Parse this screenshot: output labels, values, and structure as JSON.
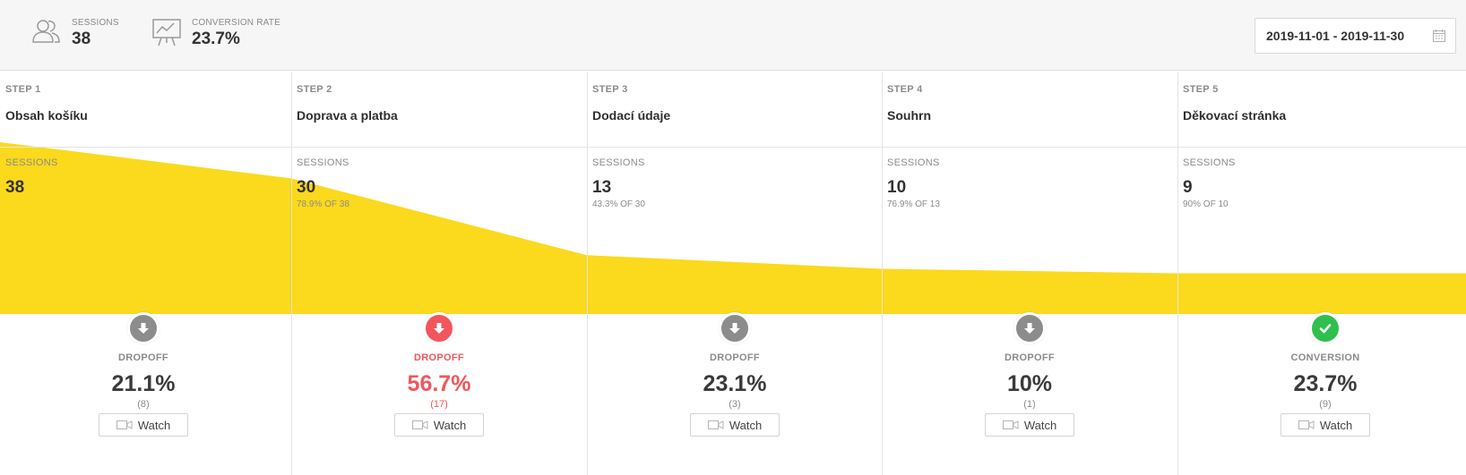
{
  "header": {
    "sessions": {
      "label": "SESSIONS",
      "value": "38",
      "icon": "users-icon"
    },
    "conversion": {
      "label": "CONVERSION RATE",
      "value": "23.7%",
      "icon": "presentation-chart-icon"
    },
    "date_range": {
      "value": "2019-11-01 - 2019-11-30",
      "icon": "calendar-icon"
    }
  },
  "colors": {
    "funnel_fill": "#fbd91c",
    "dropoff_gray": "#8c8c8c",
    "dropoff_red": "#f0565b",
    "conversion_green": "#2fbf4c"
  },
  "steps": [
    {
      "step": "STEP 1",
      "name": "Obsah košíku",
      "sessions_label": "SESSIONS",
      "sessions": "38",
      "sessions_count": 38,
      "pct_of_prev": "",
      "outcome_label": "DROPOFF",
      "outcome_value": "21.1%",
      "outcome_count": "(8)",
      "outcome_type": "gray",
      "watch_label": "Watch"
    },
    {
      "step": "STEP 2",
      "name": "Doprava a platba",
      "sessions_label": "SESSIONS",
      "sessions": "30",
      "sessions_count": 30,
      "pct_of_prev": "78.9% OF 38",
      "outcome_label": "DROPOFF",
      "outcome_value": "56.7%",
      "outcome_count": "(17)",
      "outcome_type": "red",
      "watch_label": "Watch"
    },
    {
      "step": "STEP 3",
      "name": "Dodací údaje",
      "sessions_label": "SESSIONS",
      "sessions": "13",
      "sessions_count": 13,
      "pct_of_prev": "43.3% OF 30",
      "outcome_label": "DROPOFF",
      "outcome_value": "23.1%",
      "outcome_count": "(3)",
      "outcome_type": "gray",
      "watch_label": "Watch"
    },
    {
      "step": "STEP 4",
      "name": "Souhrn",
      "sessions_label": "SESSIONS",
      "sessions": "10",
      "sessions_count": 10,
      "pct_of_prev": "76.9% OF 13",
      "outcome_label": "DROPOFF",
      "outcome_value": "10%",
      "outcome_count": "(1)",
      "outcome_type": "gray",
      "watch_label": "Watch"
    },
    {
      "step": "STEP 5",
      "name": "Děkovací stránka",
      "sessions_label": "SESSIONS",
      "sessions": "9",
      "sessions_count": 9,
      "pct_of_prev": "90% OF 10",
      "outcome_label": "CONVERSION",
      "outcome_value": "23.7%",
      "outcome_count": "(9)",
      "outcome_type": "green",
      "watch_label": "Watch"
    }
  ]
}
